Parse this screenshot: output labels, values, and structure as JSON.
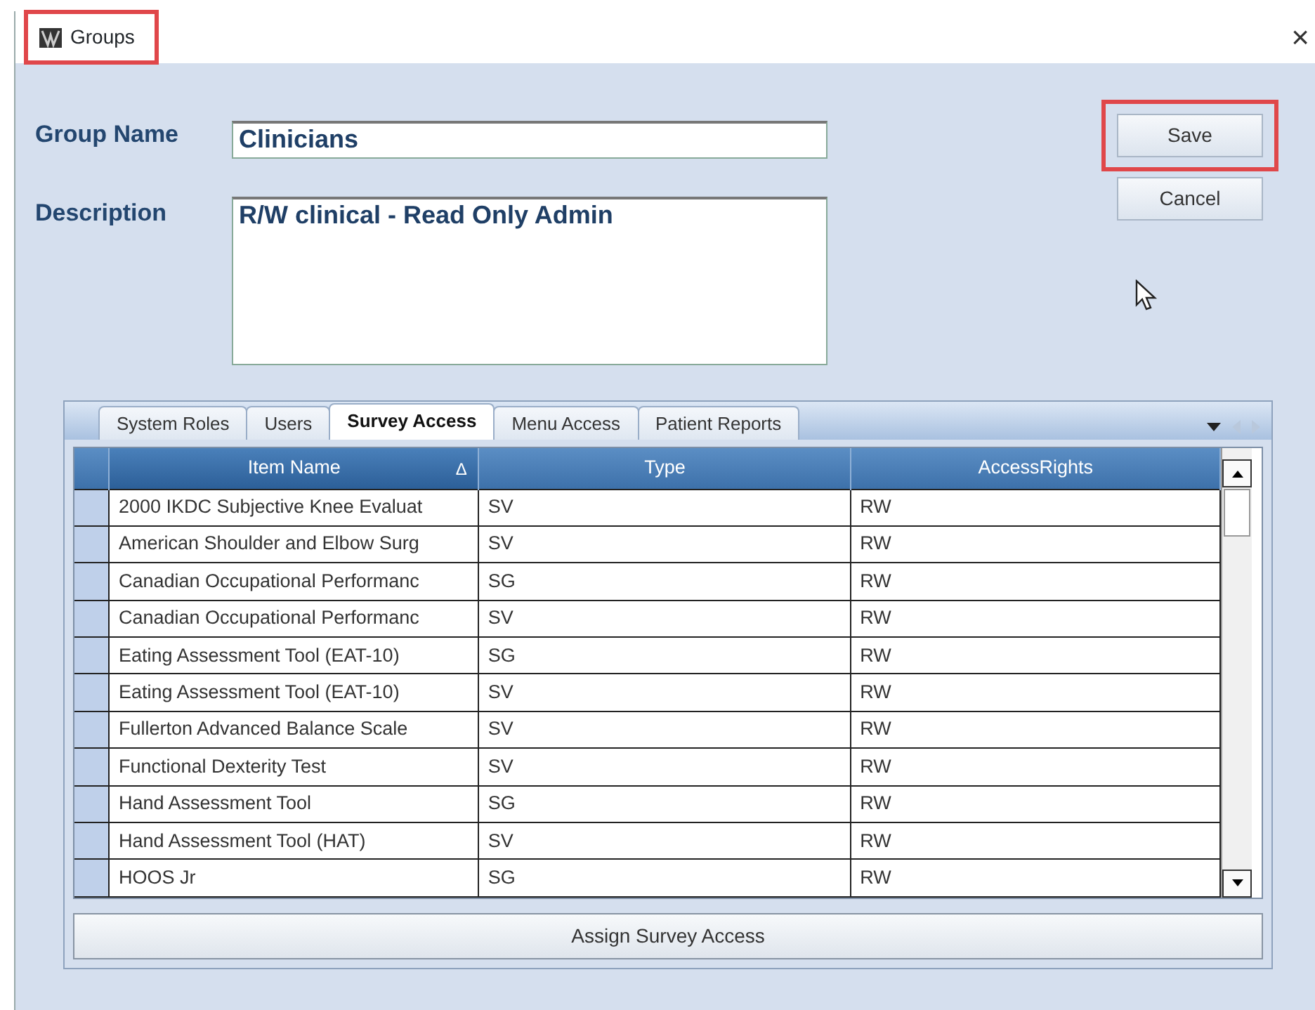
{
  "window": {
    "title": "Groups",
    "title_highlighted": true,
    "close": "×"
  },
  "form": {
    "group_name_label": "Group Name",
    "group_name": "Clinicians",
    "description_label": "Description",
    "description": "R/W clinical - Read Only Admin"
  },
  "buttons": [
    {
      "label": "Save",
      "highlighted": true
    },
    {
      "label": "Cancel",
      "highlighted": false
    }
  ],
  "tabs": [
    {
      "label": "System Roles",
      "selected": false
    },
    {
      "label": "Users",
      "selected": false
    },
    {
      "label": "Survey Access",
      "selected": true
    },
    {
      "label": "Menu Access",
      "selected": false
    },
    {
      "label": "Patient Reports",
      "selected": false
    }
  ],
  "table": {
    "columns": [
      {
        "label": "Item Name",
        "sorted": true,
        "sort_glyph": "Δ"
      },
      {
        "label": "Type",
        "sorted": false
      },
      {
        "label": "AccessRights",
        "sorted": false
      }
    ],
    "rows": [
      [
        "2000 IKDC Subjective Knee Evaluat",
        "SV",
        "RW"
      ],
      [
        "American Shoulder and Elbow Surg",
        "SV",
        "RW"
      ],
      [
        "Canadian Occupational Performanc",
        "SG",
        "RW"
      ],
      [
        "Canadian Occupational Performanc",
        "SV",
        "RW"
      ],
      [
        "Eating Assessment Tool (EAT-10)",
        "SG",
        "RW"
      ],
      [
        "Eating Assessment Tool (EAT-10)",
        "SV",
        "RW"
      ],
      [
        "Fullerton Advanced Balance Scale",
        "SV",
        "RW"
      ],
      [
        "Functional Dexterity Test",
        "SV",
        "RW"
      ],
      [
        "Hand Assessment Tool",
        "SG",
        "RW"
      ],
      [
        "Hand Assessment Tool (HAT)",
        "SV",
        "RW"
      ],
      [
        "HOOS Jr",
        "SG",
        "RW"
      ]
    ]
  },
  "assign_button": "Assign Survey Access"
}
